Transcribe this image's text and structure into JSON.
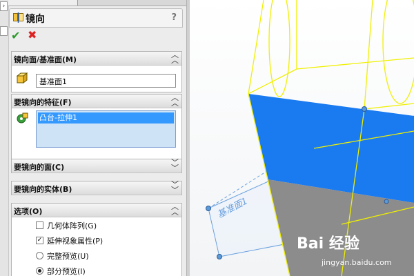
{
  "panel": {
    "title": "镜向",
    "help": "?",
    "ok_glyph": "✔",
    "cancel_glyph": "✖"
  },
  "sections": {
    "mirror_plane": {
      "label": "镜向面/基准面(M)",
      "value": "基准面1"
    },
    "features": {
      "label": "要镜向的特征(F)",
      "items": [
        "凸台-拉伸1"
      ]
    },
    "faces": {
      "label": "要镜向的面(C)"
    },
    "bodies": {
      "label": "要镜向的实体(B)"
    },
    "options": {
      "label": "选项(O)",
      "geometry_pattern": "几何体阵列(G)",
      "propagate_visual": "延伸视象属性(P)",
      "full_preview": "完整预览(U)",
      "partial_preview": "部分预览(I)"
    }
  },
  "options_state": {
    "geometry_pattern": false,
    "propagate_visual": true,
    "preview": "partial"
  },
  "viewport": {
    "plane_label": "基准面1"
  },
  "watermark": {
    "brand": "Bai 经验",
    "url": "jingyan.baidu.com"
  },
  "colors": {
    "wire": "#f0f000",
    "face_blue": "#1a7af0",
    "face_gray": "#8c8c8c",
    "plane_edge": "#6aa0e0"
  },
  "icons": {
    "title": "mirror-feature-icon",
    "plane": "plane-cube-icon",
    "feature": "feature-tree-icon"
  }
}
